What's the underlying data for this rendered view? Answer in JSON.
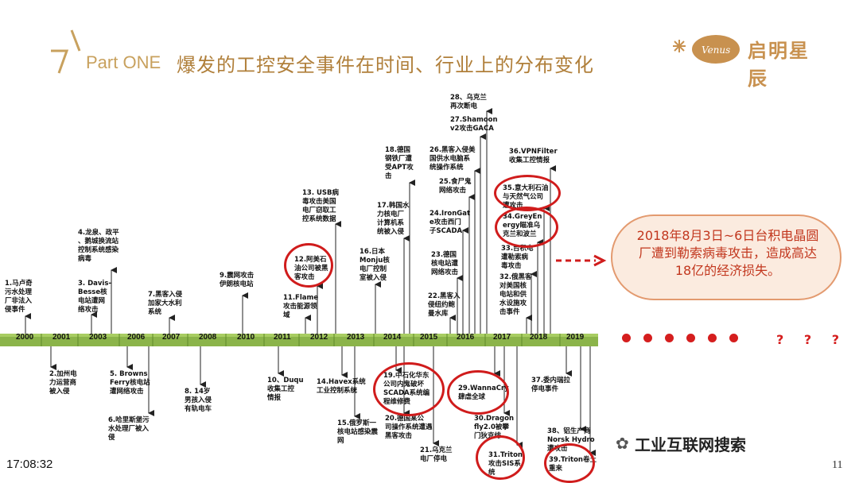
{
  "header": {
    "part_label": "Part ONE",
    "title": "爆发的工控安全事件在时间、行业上的分布变化",
    "logo_text": "启明星辰",
    "logo_mark_text": "Venus"
  },
  "colors": {
    "accent": "#c8a15e",
    "timeline_bar": "#8bb44a",
    "highlight": "#d01c1c"
  },
  "timeline": {
    "years": [
      "2000",
      "2001",
      "2003",
      "2006",
      "2007",
      "2008",
      "2010",
      "2011",
      "2012",
      "2013",
      "2014",
      "2015",
      "2016",
      "2017",
      "2018",
      "2019"
    ],
    "events_above": [
      {
        "id": "e1",
        "text": "1.马卢奇\n污水处理\n厂非法入\n侵事件"
      },
      {
        "id": "e3",
        "text": "3. Davis-\nBesse核\n电站遭网\n络攻击"
      },
      {
        "id": "e4",
        "text": "4.龙泉、政平\n、鹅城换流站\n控制系统感染\n病毒"
      },
      {
        "id": "e7",
        "text": "7.黑客入侵\n加家大水利\n系统"
      },
      {
        "id": "e9",
        "text": "9.震网攻击\n伊朗核电站"
      },
      {
        "id": "e11",
        "text": "11.Flame\n攻击能源领\n域"
      },
      {
        "id": "e12",
        "text": "12.阿美石\n油公司被黑\n客攻击"
      },
      {
        "id": "e13",
        "text": "13. USB病\n毒攻击美国\n电厂窃取工\n控系统数据"
      },
      {
        "id": "e16",
        "text": "16.日本\nMonju核\n电厂控制\n室被入侵"
      },
      {
        "id": "e17",
        "text": "17.韩国水\n力核电厂\n计算机系\n统被入侵"
      },
      {
        "id": "e18",
        "text": "18.德国\n钢铁厂遭\n受APT攻\n击"
      },
      {
        "id": "e22",
        "text": "22.黑客入\n侵纽约鲍\n曼水库"
      },
      {
        "id": "e23",
        "text": "23.德国\n核电站遭\n网络攻击"
      },
      {
        "id": "e24",
        "text": "24.IronGat\ne攻击西门\n子SCADA"
      },
      {
        "id": "e25",
        "text": "25.食尸鬼\n网络攻击"
      },
      {
        "id": "e26",
        "text": "26.黑客入侵美\n国供水电脑系\n统操作系统"
      },
      {
        "id": "e27",
        "text": "27.Shamoon\nv2攻击GACA"
      },
      {
        "id": "e28",
        "text": "28、乌克兰\n再次断电"
      },
      {
        "id": "e32",
        "text": "32.俄黑客\n对美国核\n电站和供\n水设施攻\n击事件"
      },
      {
        "id": "e33",
        "text": "33.台积电\n遭勒索病\n毒攻击"
      },
      {
        "id": "e34",
        "text": "34.GreyEn\nergy瞄准乌\n克兰和波兰"
      },
      {
        "id": "e35",
        "text": "35.意大利石油\n与天然气公司\n遭攻击"
      },
      {
        "id": "e36",
        "text": "36.VPNFilter\n收集工控情报"
      }
    ],
    "events_below": [
      {
        "id": "e2",
        "text": "2.加州电\n力运营商\n被入侵"
      },
      {
        "id": "e5",
        "text": "5. Browns\nFerry核电站\n遭网络攻击"
      },
      {
        "id": "e6",
        "text": "6.哈里斯堡污\n水处理厂被入\n侵"
      },
      {
        "id": "e8",
        "text": "8. 14岁\n男孩入侵\n有轨电车"
      },
      {
        "id": "e10",
        "text": "10、Duqu\n收集工控\n情报"
      },
      {
        "id": "e14",
        "text": "14.Havex系统\n工业控制系统"
      },
      {
        "id": "e15",
        "text": "15.俄罗斯一\n核电站感染震\n网"
      },
      {
        "id": "e19",
        "text": "19.中石化华东\n公司内鬼破坏\nSCADA系统编\n程维修费"
      },
      {
        "id": "e20",
        "text": "20.德国某公\n司操作系统遭遇\n黑客攻击"
      },
      {
        "id": "e21",
        "text": "21.乌克兰\n电厂停电"
      },
      {
        "id": "e29",
        "text": "29.WannaCry\n肆虐全球"
      },
      {
        "id": "e30",
        "text": "30.Dragon\nfly2.0被攀\n门狄克绯"
      },
      {
        "id": "e31",
        "text": "31.Triton\n攻击SIS系\n统"
      },
      {
        "id": "e37",
        "text": "37.委内瑞拉\n停电事件"
      },
      {
        "id": "e38",
        "text": "38、铝生产商\nNorsk Hydro\n遭攻击"
      },
      {
        "id": "e39",
        "text": "39.Triton卷土\n重来"
      }
    ]
  },
  "callout": {
    "text": "2018年8月3日~6日台积电晶圆厂遭到勒索病毒攻击，造成高达18亿的经济损失。"
  },
  "future": {
    "question_marks": "? ? ?"
  },
  "footer": {
    "time": "17:08:32",
    "page_number": "11",
    "watermark": "工业互联网搜索"
  }
}
